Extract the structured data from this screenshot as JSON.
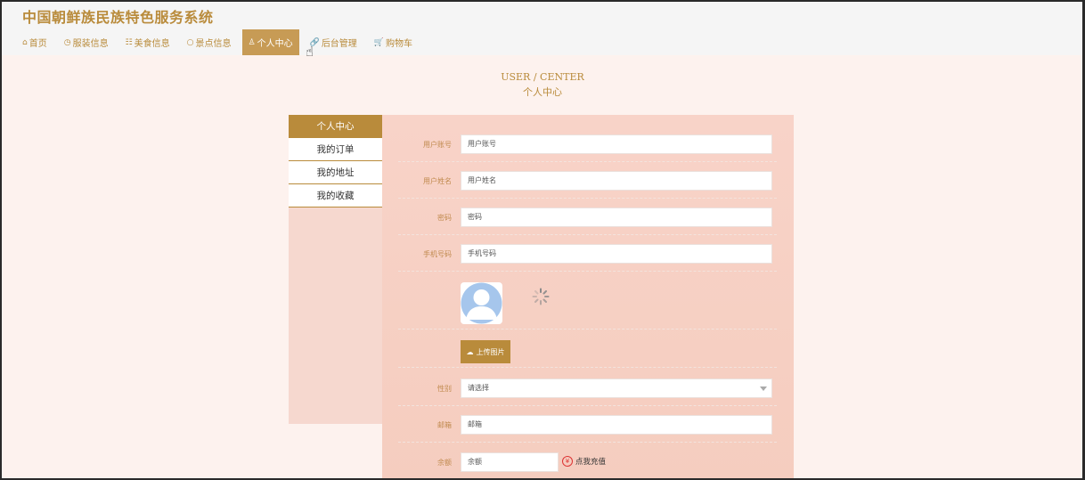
{
  "site": {
    "title": "中国朝鲜族民族特色服务系统"
  },
  "nav": [
    {
      "icon": "⌂",
      "icon_name": "home-icon",
      "label": "首页"
    },
    {
      "icon": "◷",
      "icon_name": "clock-icon",
      "label": "服装信息"
    },
    {
      "icon": "☷",
      "icon_name": "grid-icon",
      "label": "美食信息"
    },
    {
      "icon": "○",
      "icon_name": "circle-icon",
      "label": "景点信息"
    },
    {
      "icon": "♙",
      "icon_name": "user-icon",
      "label": "个人中心",
      "active": true
    },
    {
      "icon": "🔗",
      "icon_name": "link-icon",
      "label": "后台管理"
    },
    {
      "icon": "🛒",
      "icon_name": "cart-icon",
      "label": "购物车"
    }
  ],
  "section": {
    "title_en": "USER / CENTER",
    "title_cn": "个人中心"
  },
  "sidebar": [
    {
      "label": "个人中心",
      "active": true
    },
    {
      "label": "我的订单"
    },
    {
      "label": "我的地址"
    },
    {
      "label": "我的收藏"
    }
  ],
  "form": {
    "account_label": "用户账号",
    "account_placeholder": "用户账号",
    "name_label": "用户姓名",
    "name_placeholder": "用户姓名",
    "password_label": "密码",
    "password_placeholder": "密码",
    "phone_label": "手机号码",
    "phone_placeholder": "手机号码",
    "upload_label": "上传图片",
    "gender_label": "性别",
    "gender_value": "请选择",
    "email_label": "邮箱",
    "email_placeholder": "邮箱",
    "balance_label": "余额",
    "balance_placeholder": "余额",
    "recharge_label": "点我充值"
  },
  "colors": {
    "accent": "#b98b3b",
    "panel": "#f8d3c8",
    "background": "#fdf2ee"
  }
}
